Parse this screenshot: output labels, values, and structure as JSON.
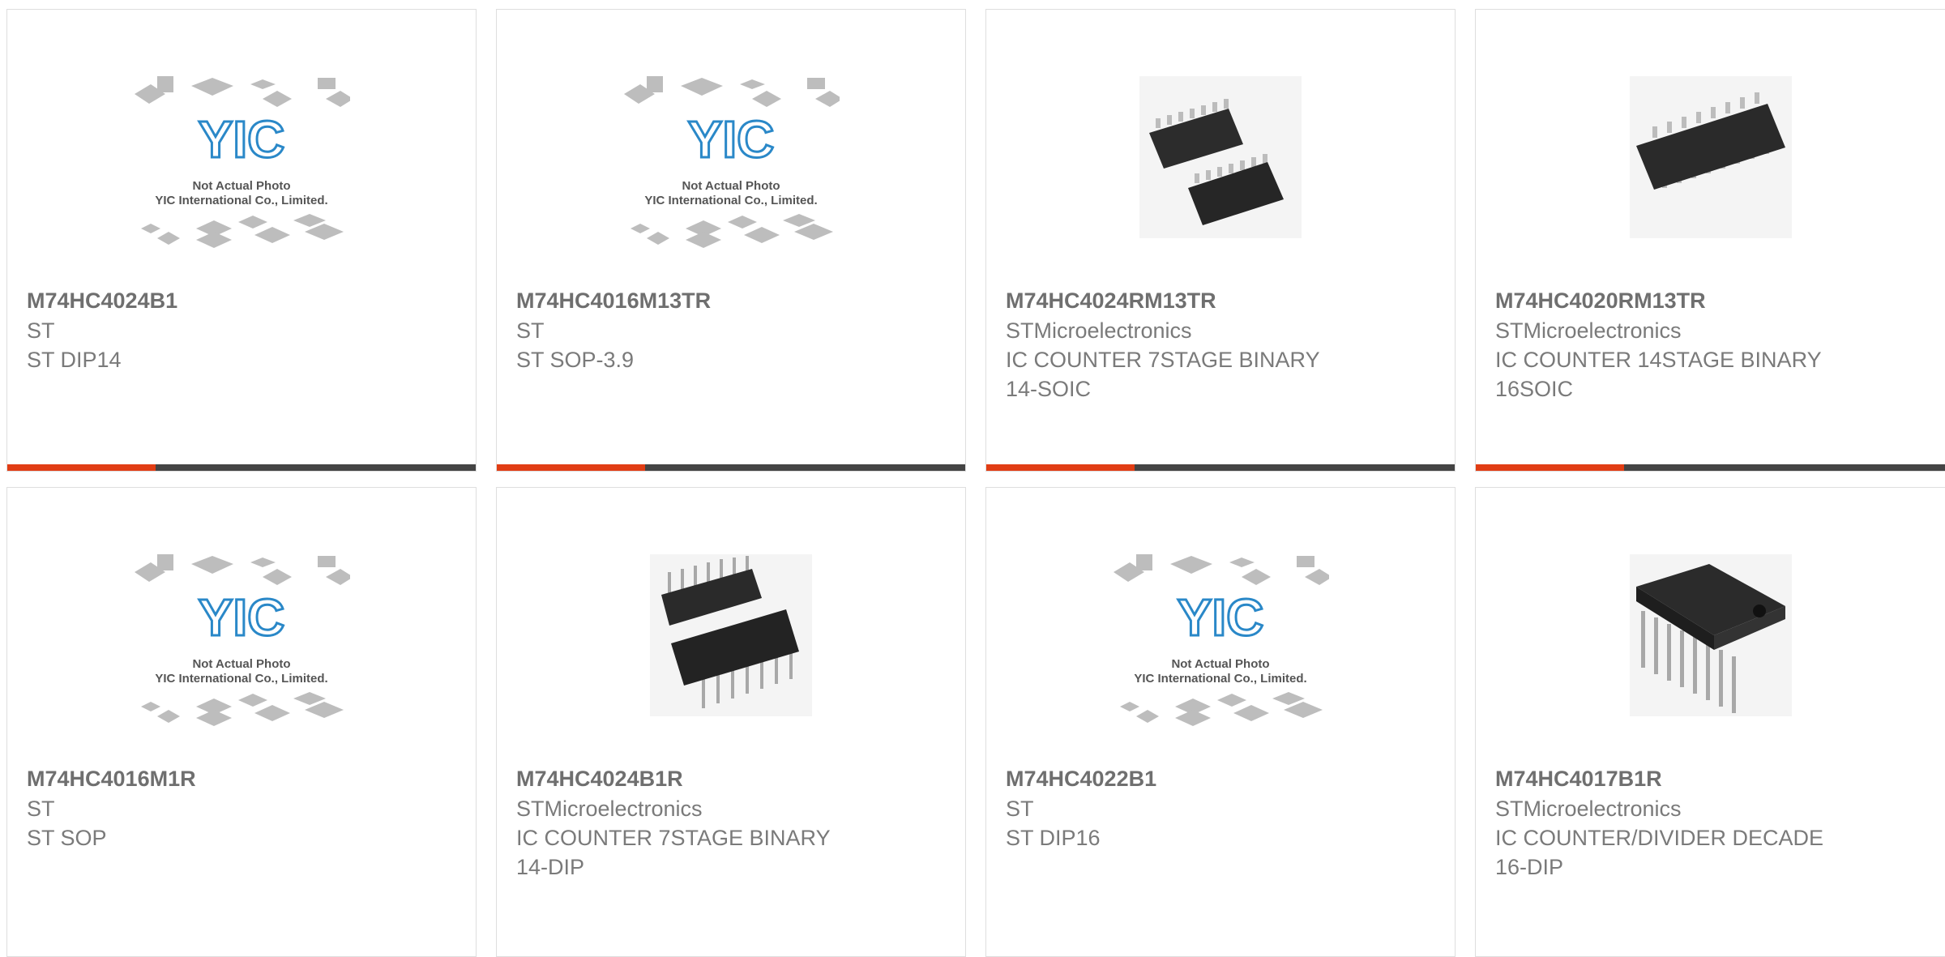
{
  "accent": "#e13d14",
  "products": [
    {
      "pn": "M74HC4024B1",
      "lines": [
        "ST",
        "ST DIP14"
      ],
      "image": "yic-placeholder-icon"
    },
    {
      "pn": "M74HC4016M13TR",
      "lines": [
        "ST",
        "ST SOP-3.9"
      ],
      "image": "yic-placeholder-icon"
    },
    {
      "pn": "M74HC4024RM13TR",
      "lines": [
        "STMicroelectronics",
        "IC COUNTER 7STAGE BINARY",
        "14-SOIC"
      ],
      "image": "soic-pair-icon"
    },
    {
      "pn": "M74HC4020RM13TR",
      "lines": [
        "STMicroelectronics",
        "IC COUNTER 14STAGE BINARY",
        "16SOIC"
      ],
      "image": "soic-single-icon"
    },
    {
      "pn": "M74HC4016M1R",
      "lines": [
        "ST",
        "ST SOP"
      ],
      "image": "yic-placeholder-icon"
    },
    {
      "pn": "M74HC4024B1R",
      "lines": [
        "STMicroelectronics",
        "IC COUNTER 7STAGE BINARY",
        "14-DIP"
      ],
      "image": "dip-pair-icon"
    },
    {
      "pn": "M74HC4022B1",
      "lines": [
        "ST",
        "ST DIP16"
      ],
      "image": "yic-placeholder-icon"
    },
    {
      "pn": "M74HC4017B1R",
      "lines": [
        "STMicroelectronics",
        "IC COUNTER/DIVIDER DECADE",
        "16-DIP"
      ],
      "image": "dip-single-icon"
    }
  ],
  "placeholder": {
    "logo": "YIC",
    "caption1": "Not Actual Photo",
    "caption2": "YIC International Co., Limited."
  }
}
